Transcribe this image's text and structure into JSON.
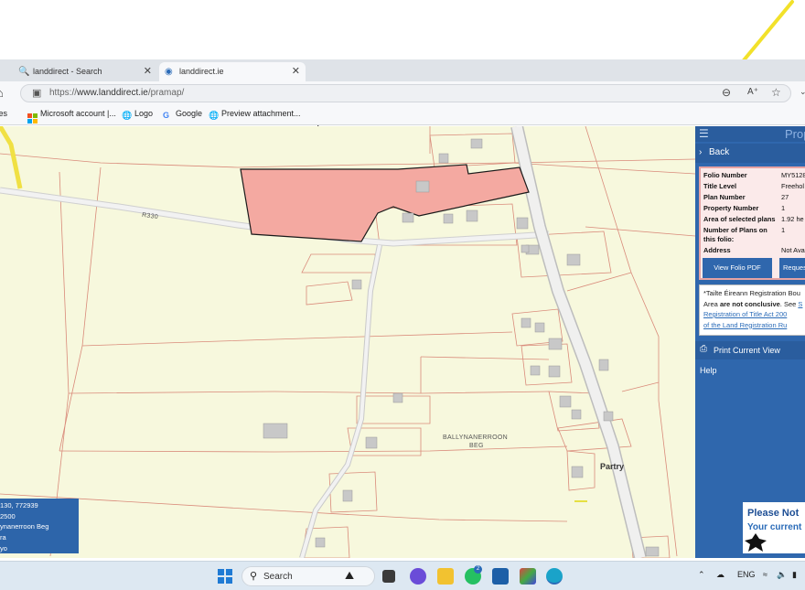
{
  "browser": {
    "tabs": [
      {
        "label": "landdirect - Search",
        "icon": "search-icon",
        "active": false
      },
      {
        "label": "landdirect.ie",
        "icon": "site-icon",
        "active": true
      }
    ],
    "url_scheme": "https://",
    "url_host": "www.landdirect.ie",
    "url_path": "/pramap/",
    "bookmarks": [
      {
        "label": "tes"
      },
      {
        "label": "Microsoft account |..."
      },
      {
        "label": "Logo"
      },
      {
        "label": "Google"
      },
      {
        "label": "Preview attachment..."
      }
    ]
  },
  "map": {
    "road_label": "R330",
    "townland_label_line1": "BALLYNANERROON",
    "townland_label_line2": "BEG",
    "town_label": "Partry",
    "highlight_color": "#f4a9a1",
    "info_box": {
      "coords": "130, 772939",
      "scale": "2500",
      "townland": "ynanerroon Beg",
      "line4": "ra",
      "line5": "yo"
    }
  },
  "panel": {
    "title": "Prop",
    "back_label": "Back",
    "details": [
      {
        "label": "Folio Number",
        "value": "MY5128"
      },
      {
        "label": "Title Level",
        "value": "Freehol"
      },
      {
        "label": "Plan Number",
        "value": "27"
      },
      {
        "label": "Property Number",
        "value": "1"
      },
      {
        "label": "Area of selected plans",
        "value": "1.92 he"
      },
      {
        "label": "Number of Plans on",
        "label2": "this folio:",
        "value": "1"
      },
      {
        "label": "Address",
        "value": "Not Ava"
      }
    ],
    "view_pdf_label": "View Folio PDF",
    "request_label": "Reques",
    "notice_line1": "*Tailte Éireann Registration Bou",
    "notice_line2_pre": "Area ",
    "notice_line2_bold": "are not conclusive",
    "notice_line2_post": ". See ",
    "notice_line2_link": "S",
    "notice_line3": "Registration of Title Act 200",
    "notice_line4": "of the Land Registration Ru",
    "print_label": "Print Current View",
    "help_label": "Help",
    "please_note": "Please Not",
    "your_current": "Your current"
  },
  "taskbar": {
    "search_label": "Search",
    "lang": "ENG",
    "chat_badge": "2"
  }
}
